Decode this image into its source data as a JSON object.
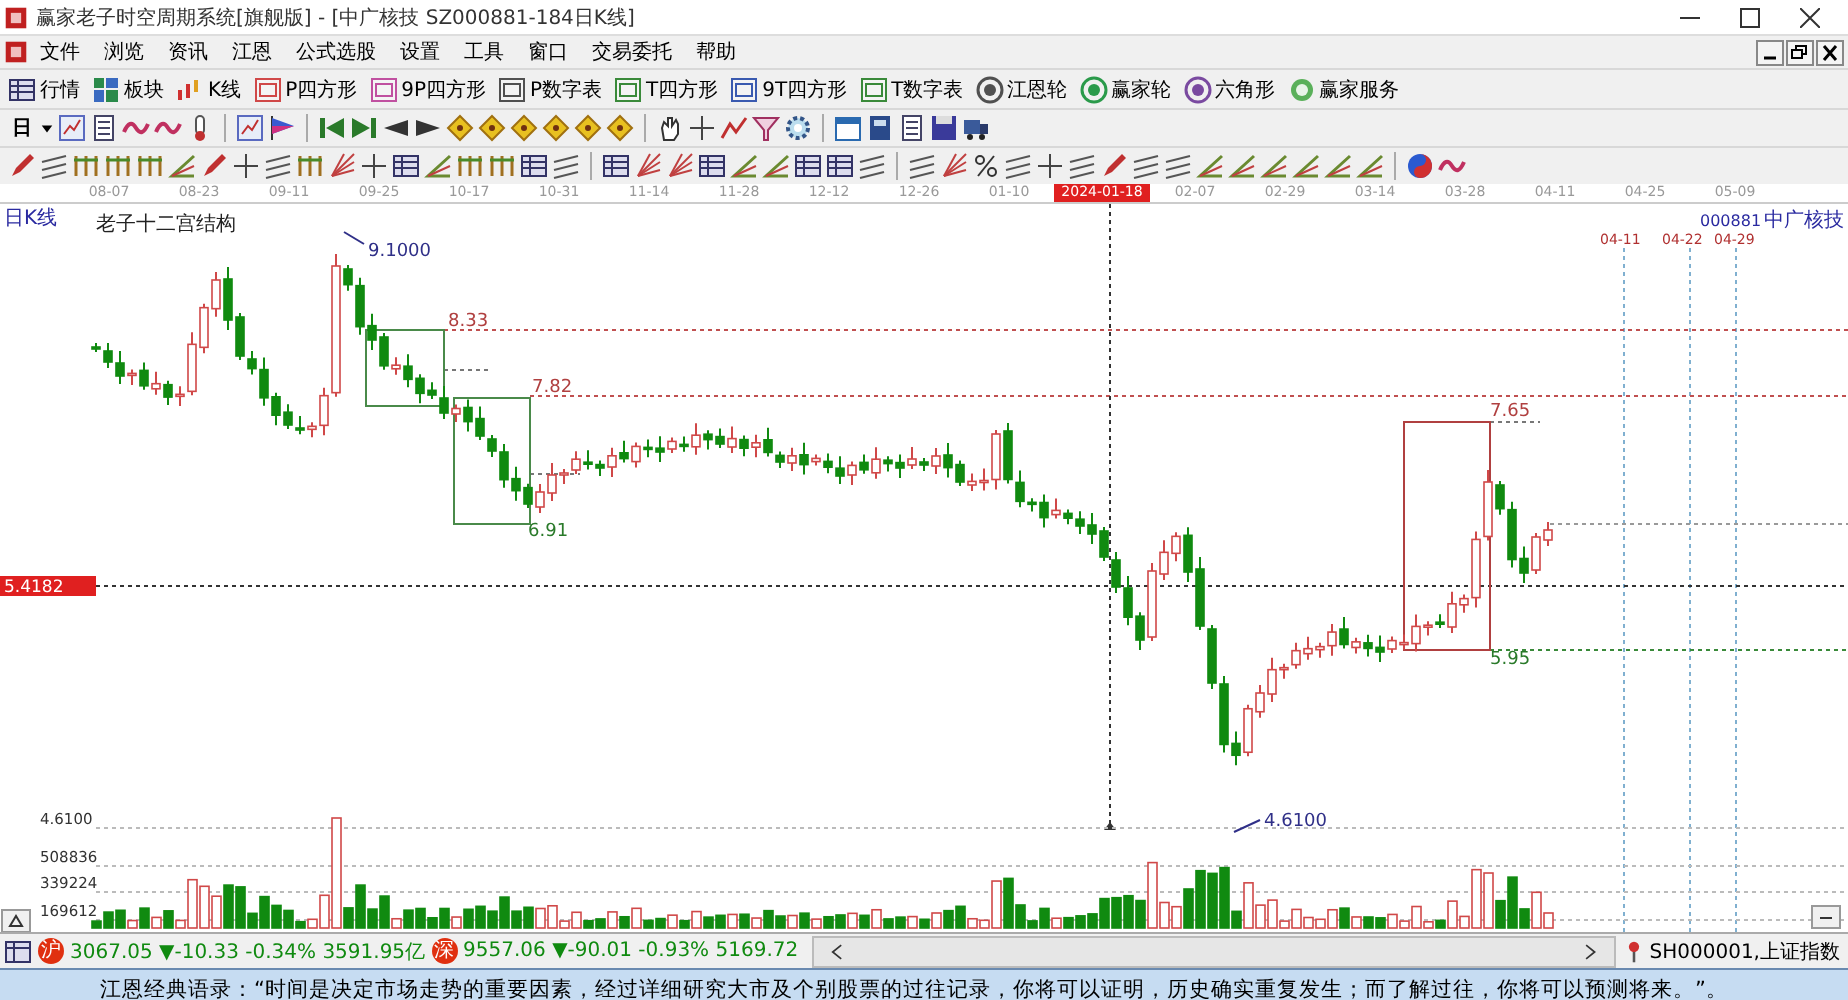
{
  "window": {
    "title": "赢家老子时空周期系统[旗舰版] - [中广核技 SZ000881-184日K线]"
  },
  "menu": [
    "文件",
    "浏览",
    "资讯",
    "江恩",
    "公式选股",
    "设置",
    "工具",
    "窗口",
    "交易委托",
    "帮助"
  ],
  "toolbar": [
    "行情",
    "板块",
    "K线",
    "P四方形",
    "9P四方形",
    "P数字表",
    "T四方形",
    "9T四方形",
    "T数字表",
    "江恩轮",
    "赢家轮",
    "六角形",
    "赢家服务"
  ],
  "period_selector": "日",
  "date_axis": [
    {
      "label": "08-07",
      "selected": false
    },
    {
      "label": "08-23",
      "selected": false
    },
    {
      "label": "09-11",
      "selected": false
    },
    {
      "label": "09-25",
      "selected": false
    },
    {
      "label": "10-17",
      "selected": false
    },
    {
      "label": "10-31",
      "selected": false
    },
    {
      "label": "11-14",
      "selected": false
    },
    {
      "label": "11-28",
      "selected": false
    },
    {
      "label": "12-12",
      "selected": false
    },
    {
      "label": "12-26",
      "selected": false
    },
    {
      "label": "01-10",
      "selected": false
    },
    {
      "label": "2024-01-18",
      "selected": true
    },
    {
      "label": "02-07",
      "selected": false
    },
    {
      "label": "02-29",
      "selected": false
    },
    {
      "label": "03-14",
      "selected": false
    },
    {
      "label": "03-28",
      "selected": false
    },
    {
      "label": "04-11",
      "selected": false
    },
    {
      "label": "04-25",
      "selected": false
    },
    {
      "label": "05-09",
      "selected": false
    }
  ],
  "chart": {
    "period": "日K线",
    "indicator": "老子十二宫结构",
    "code": "000881",
    "name": "中广核技",
    "current_price": "5.4182",
    "labels": [
      {
        "text": "9.1000",
        "kind": "extreme"
      },
      {
        "text": "8.33",
        "kind": "resistance"
      },
      {
        "text": "7.82",
        "kind": "resistance"
      },
      {
        "text": "6.91",
        "kind": "support"
      },
      {
        "text": "7.65",
        "kind": "resistance"
      },
      {
        "text": "5.95",
        "kind": "support"
      },
      {
        "text": "4.6100",
        "kind": "extreme"
      }
    ],
    "time_markers": [
      "04-11",
      "04-22",
      "04-29"
    ],
    "volume_axis": [
      "4.6100",
      "508836",
      "339224",
      "169612"
    ]
  },
  "index_bar": [
    {
      "badge": "沪",
      "quote": "3067.05 ▼-10.33 -0.34% 3591.95亿"
    },
    {
      "badge": "深",
      "quote": "9557.06 ▼-90.01 -0.93% 5169.72"
    }
  ],
  "index_name": "SH000001,上证指数",
  "quote": "江恩经典语录：“时间是决定市场走势的重要因素，经过详细研究大市及个别股票的过往记录，你将可以证明，历史确实重复发生；而了解过往，你将可以预测将来。”。"
}
